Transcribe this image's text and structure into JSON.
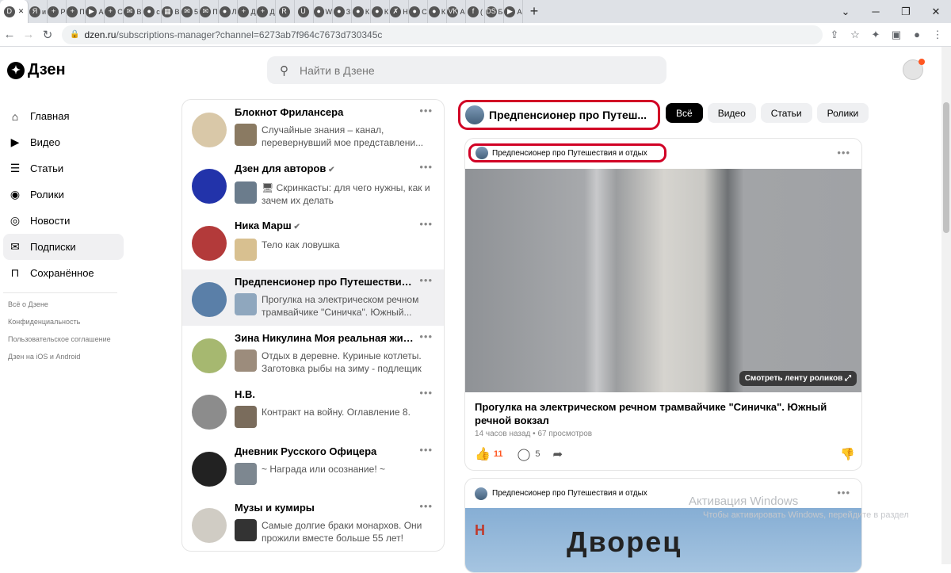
{
  "browser": {
    "tabs": [
      {
        "icon": "D",
        "label": ""
      },
      {
        "icon": "Я",
        "label": "и"
      },
      {
        "icon": "+",
        "label": "Р"
      },
      {
        "icon": "+",
        "label": "П"
      },
      {
        "icon": "▶",
        "label": "А"
      },
      {
        "icon": "+",
        "label": "С"
      },
      {
        "icon": "✉",
        "label": "В"
      },
      {
        "icon": "●",
        "label": "с"
      },
      {
        "icon": "▦",
        "label": "В"
      },
      {
        "icon": "✉",
        "label": "5"
      },
      {
        "icon": "✉",
        "label": "П"
      },
      {
        "icon": "●",
        "label": "Л"
      },
      {
        "icon": "+",
        "label": "Д"
      },
      {
        "icon": "+",
        "label": "Д"
      },
      {
        "icon": "R",
        "label": ""
      },
      {
        "icon": "U",
        "label": ""
      },
      {
        "icon": "●",
        "label": "W"
      },
      {
        "icon": "●",
        "label": "З"
      },
      {
        "icon": "●",
        "label": "К"
      },
      {
        "icon": "●",
        "label": "К"
      },
      {
        "icon": "✗",
        "label": "Н"
      },
      {
        "icon": "●",
        "label": "С"
      },
      {
        "icon": "●",
        "label": "К"
      },
      {
        "icon": "VK",
        "label": "А"
      },
      {
        "icon": "f",
        "label": "("
      },
      {
        "icon": "DS",
        "label": "Б"
      },
      {
        "icon": "▶",
        "label": "А"
      }
    ],
    "window_controls": [
      "⌄",
      "─",
      "❐",
      "✕"
    ],
    "url_host": "dzen.ru",
    "url_path": "/subscriptions-manager?channel=6273ab7f964c7673d730345c"
  },
  "header": {
    "logo": "Дзен",
    "search_placeholder": "Найти в Дзене"
  },
  "sidebar": {
    "items": [
      {
        "icon": "⌂",
        "label": "Главная",
        "active": false
      },
      {
        "icon": "▶",
        "label": "Видео",
        "active": false
      },
      {
        "icon": "☰",
        "label": "Статьи",
        "active": false
      },
      {
        "icon": "◉",
        "label": "Ролики",
        "active": false
      },
      {
        "icon": "◎",
        "label": "Новости",
        "active": false
      },
      {
        "icon": "✉",
        "label": "Подписки",
        "active": true
      },
      {
        "icon": "⊓",
        "label": "Сохранённое",
        "active": false
      }
    ],
    "footer": [
      "Всё о Дзене",
      "Конфиденциальность",
      "Пользовательское соглашение",
      "Дзен на iOS и Android"
    ]
  },
  "subscriptions": [
    {
      "name": "Блокнот Фрилансера",
      "verified": false,
      "text": "Случайные знания – канал, перевернувший мое представлени...",
      "avatar": "#d9c8a8",
      "thumb": "#8a7a62",
      "selected": false
    },
    {
      "name": "Дзен для авторов",
      "verified": true,
      "text": "🖥 Скринкасты: для чего нужны, как и зачем их делать",
      "avatar": "#2233aa",
      "thumb": "#6b7c8c",
      "selected": false
    },
    {
      "name": "Ника Марш",
      "verified": true,
      "text": "Тело как ловушка",
      "avatar": "#b33a3a",
      "thumb": "#d8c090",
      "selected": false
    },
    {
      "name": "Предпенсионер про Путешествия и ...",
      "verified": false,
      "text": "Прогулка на электрическом речном трамвайчике \"Синичка\". Южный...",
      "avatar": "#5a7fa8",
      "thumb": "#8fa7be",
      "selected": true
    },
    {
      "name": "Зина Никулина Моя реальная жизнь",
      "verified": false,
      "text": "Отдых в деревне. Куриные котлеты. Заготовка рыбы на зиму - подлещик",
      "avatar": "#a6b870",
      "thumb": "#9c8c7c",
      "selected": false
    },
    {
      "name": "Н.В.",
      "verified": false,
      "text": "Контракт на войну. Оглавление 8.",
      "avatar": "#8c8c8c",
      "thumb": "#7a6c5c",
      "selected": false
    },
    {
      "name": "Дневник Русского Офицера",
      "verified": false,
      "text": "~ Награда или осознание! ~",
      "avatar": "#222222",
      "thumb": "#7d8790",
      "selected": false
    },
    {
      "name": "Музы и кумиры",
      "verified": false,
      "text": "Самые долгие браки монархов. Они прожили вместе больше 55 лет!",
      "avatar": "#d0ccc4",
      "thumb": "#333333",
      "selected": false
    }
  ],
  "channel": {
    "title": "Предпенсионер про Путеш...",
    "full_name": "Предпенсионер про Путешествия и отдых",
    "filters": [
      {
        "label": "Всё",
        "active": true
      },
      {
        "label": "Видео",
        "active": false
      },
      {
        "label": "Статьи",
        "active": false
      },
      {
        "label": "Ролики",
        "active": false
      }
    ]
  },
  "post": {
    "media_button": "Смотреть ленту роликов ⤢",
    "title": "Прогулка на электрическом речном трамвайчике \"Синичка\". Южный речной вокзал",
    "meta": "14 часов назад • 67 просмотров",
    "likes": "11",
    "comments": "5"
  },
  "post2": {
    "channel": "Предпенсионер про Путешествия и отдых",
    "overlay_text": "Дворец",
    "logo_text": "H"
  },
  "watermark": {
    "line1": "Активация Windows",
    "line2": "Чтобы активировать Windows, перейдите в раздел"
  }
}
